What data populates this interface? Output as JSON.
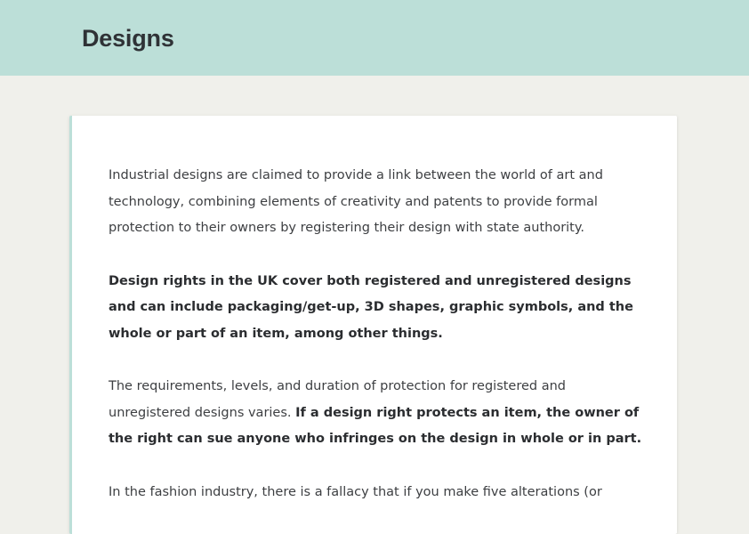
{
  "header": {
    "title": "Designs"
  },
  "article": {
    "p1": "Industrial designs are claimed to provide a link between the world of art and technology, combining elements of creativity and patents to provide formal protection to their owners by registering their design with state authority.",
    "p2": "Design rights in the UK cover both registered and unregistered designs and can include packaging/get-up, 3D shapes, graphic symbols, and the whole or part of an item, among other things.",
    "p3_normal": "The requirements, levels, and duration of protection for registered and unregistered designs varies. ",
    "p3_bold": "If a design right protects an item, the owner of the right can sue anyone who infringes on the design in whole or in part.",
    "p4": "In the fashion industry, there is a fallacy that if you make five alterations (or"
  },
  "colors": {
    "header_bg": "#bcdfd8",
    "page_bg": "#f0f0eb",
    "card_bg": "#ffffff",
    "text": "#3d3f42"
  }
}
